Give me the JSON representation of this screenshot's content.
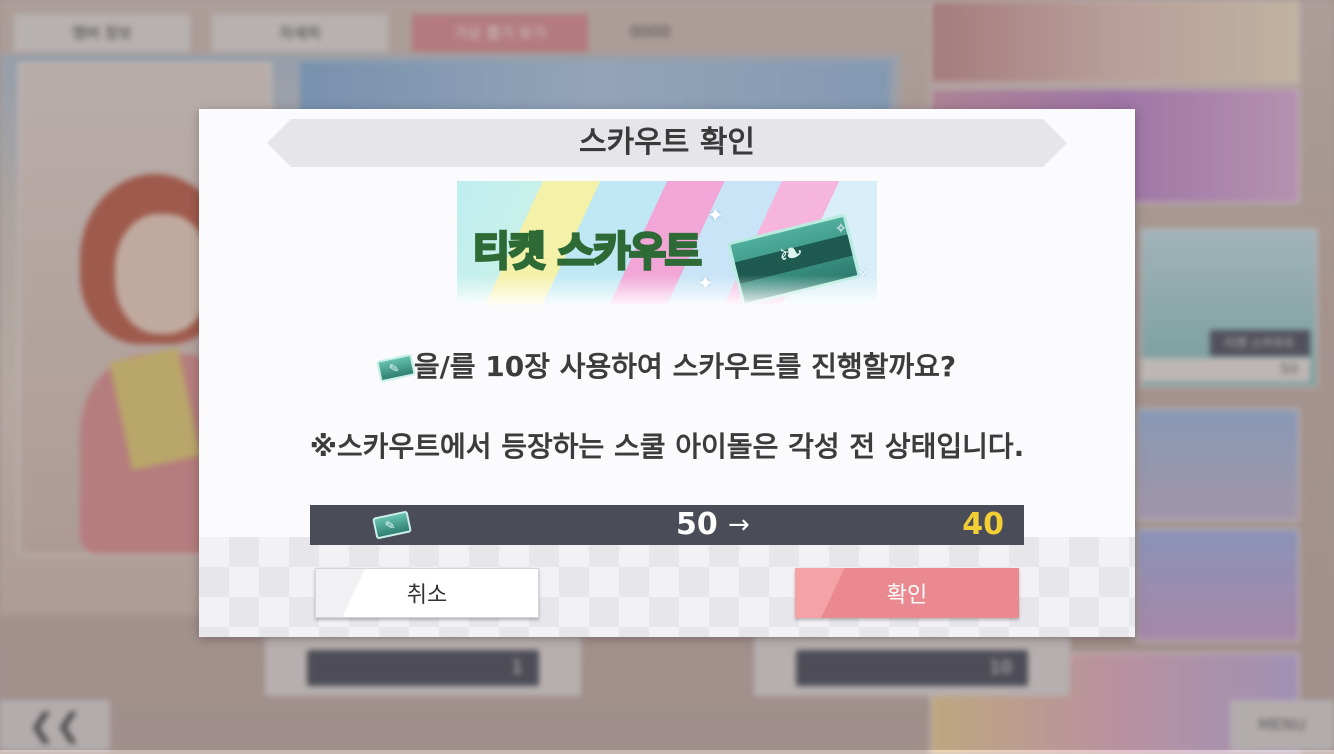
{
  "background": {
    "top_buttons": [
      "멤버 정보",
      "자세히",
      "가상 뽑기 보기"
    ],
    "gem_count": "0000",
    "counters": [
      "1",
      "10"
    ],
    "banner_label": "티켓 스카우트",
    "banner_count": "50",
    "back_label": "❮❮",
    "menu_label": "MENU"
  },
  "dialog": {
    "title": "스카우트 확인",
    "banner_logo": "티켓 스카우트",
    "message_suffix": "을/를 10장 사용하여 스카우트를 진행할까요?",
    "notice": "※스카우트에서 등장하는 스쿨 아이돌은 각성 전 상태입니다.",
    "ticket_before": "50",
    "arrow": "→",
    "ticket_after": "40",
    "cancel_label": "취소",
    "confirm_label": "확인"
  },
  "colors": {
    "confirm": "#ea8a90",
    "counter_bg": "#4a4c57",
    "after_value": "#f3cf35"
  },
  "icons": [
    "scout-ticket-icon",
    "feather-icon",
    "sparkle-icon"
  ]
}
